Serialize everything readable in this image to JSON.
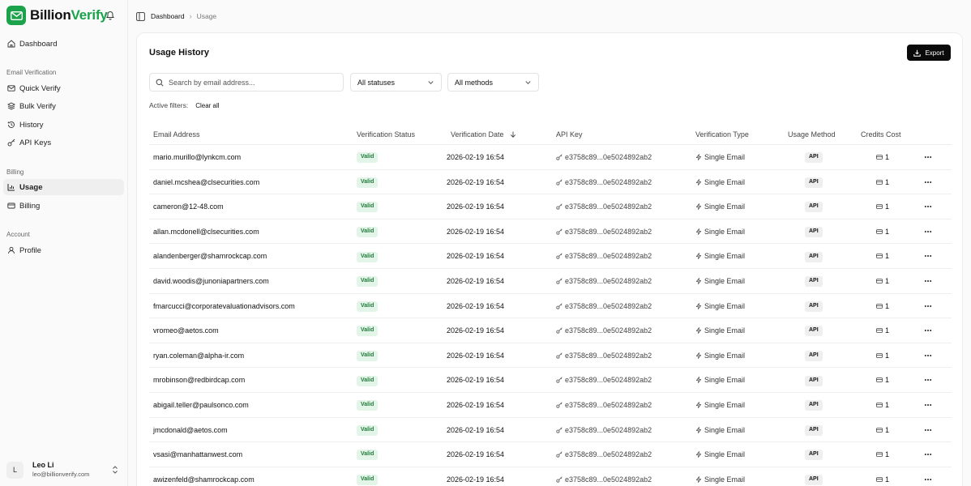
{
  "brand": {
    "name_part1": "Billion",
    "name_part2": "Verify"
  },
  "nav": {
    "dashboard": "Dashboard",
    "section_email": "Email Verification",
    "quick_verify": "Quick Verify",
    "bulk_verify": "Bulk Verify",
    "history": "History",
    "api_keys": "API Keys",
    "section_billing": "Billing",
    "usage": "Usage",
    "billing": "Billing",
    "section_account": "Account",
    "profile": "Profile"
  },
  "user": {
    "initial": "L",
    "name": "Leo Li",
    "email": "leo@billionverify.com"
  },
  "breadcrumb": {
    "parent": "Dashboard",
    "current": "Usage"
  },
  "card": {
    "title": "Usage History",
    "export_label": "Export",
    "search_placeholder": "Search by email address...",
    "status_filter": "All statuses",
    "method_filter": "All methods",
    "active_filters_label": "Active filters:",
    "clear_all": "Clear all"
  },
  "table": {
    "columns": {
      "email": "Email Address",
      "status": "Verification Status",
      "date": "Verification Date",
      "key": "API Key",
      "type": "Verification Type",
      "method": "Usage Method",
      "cost": "Credits Cost"
    },
    "rows": [
      {
        "email": "mario.murillo@lynkcm.com",
        "status": "Valid",
        "date": "2026-02-19 16:54",
        "key": "e3758c89...0e5024892ab2",
        "type": "Single Email",
        "method": "API",
        "cost": "1"
      },
      {
        "email": "daniel.mcshea@clsecurities.com",
        "status": "Valid",
        "date": "2026-02-19 16:54",
        "key": "e3758c89...0e5024892ab2",
        "type": "Single Email",
        "method": "API",
        "cost": "1"
      },
      {
        "email": "cameron@12-48.com",
        "status": "Valid",
        "date": "2026-02-19 16:54",
        "key": "e3758c89...0e5024892ab2",
        "type": "Single Email",
        "method": "API",
        "cost": "1"
      },
      {
        "email": "allan.mcdonell@clsecurities.com",
        "status": "Valid",
        "date": "2026-02-19 16:54",
        "key": "e3758c89...0e5024892ab2",
        "type": "Single Email",
        "method": "API",
        "cost": "1"
      },
      {
        "email": "alandenberger@shamrockcap.com",
        "status": "Valid",
        "date": "2026-02-19 16:54",
        "key": "e3758c89...0e5024892ab2",
        "type": "Single Email",
        "method": "API",
        "cost": "1"
      },
      {
        "email": "david.woodis@junoniapartners.com",
        "status": "Valid",
        "date": "2026-02-19 16:54",
        "key": "e3758c89...0e5024892ab2",
        "type": "Single Email",
        "method": "API",
        "cost": "1"
      },
      {
        "email": "fmarcucci@corporatevaluationadvisors.com",
        "status": "Valid",
        "date": "2026-02-19 16:54",
        "key": "e3758c89...0e5024892ab2",
        "type": "Single Email",
        "method": "API",
        "cost": "1"
      },
      {
        "email": "vromeo@aetos.com",
        "status": "Valid",
        "date": "2026-02-19 16:54",
        "key": "e3758c89...0e5024892ab2",
        "type": "Single Email",
        "method": "API",
        "cost": "1"
      },
      {
        "email": "ryan.coleman@alpha-ir.com",
        "status": "Valid",
        "date": "2026-02-19 16:54",
        "key": "e3758c89...0e5024892ab2",
        "type": "Single Email",
        "method": "API",
        "cost": "1"
      },
      {
        "email": "mrobinson@redbirdcap.com",
        "status": "Valid",
        "date": "2026-02-19 16:54",
        "key": "e3758c89...0e5024892ab2",
        "type": "Single Email",
        "method": "API",
        "cost": "1"
      },
      {
        "email": "abigail.teller@paulsonco.com",
        "status": "Valid",
        "date": "2026-02-19 16:54",
        "key": "e3758c89...0e5024892ab2",
        "type": "Single Email",
        "method": "API",
        "cost": "1"
      },
      {
        "email": "jmcdonald@aetos.com",
        "status": "Valid",
        "date": "2026-02-19 16:54",
        "key": "e3758c89...0e5024892ab2",
        "type": "Single Email",
        "method": "API",
        "cost": "1"
      },
      {
        "email": "vsasi@manhattanwest.com",
        "status": "Valid",
        "date": "2026-02-19 16:54",
        "key": "e3758c89...0e5024892ab2",
        "type": "Single Email",
        "method": "API",
        "cost": "1"
      },
      {
        "email": "awizenfeld@shamrockcap.com",
        "status": "Valid",
        "date": "2026-02-19 16:54",
        "key": "e3758c89...0e5024892ab2",
        "type": "Single Email",
        "method": "API",
        "cost": "1"
      }
    ]
  },
  "colors": {
    "brand_green": "#1aa34a",
    "valid_bg": "#e3f5e8",
    "valid_text": "#1f7a3a",
    "button_dark": "#0a0a0a"
  }
}
